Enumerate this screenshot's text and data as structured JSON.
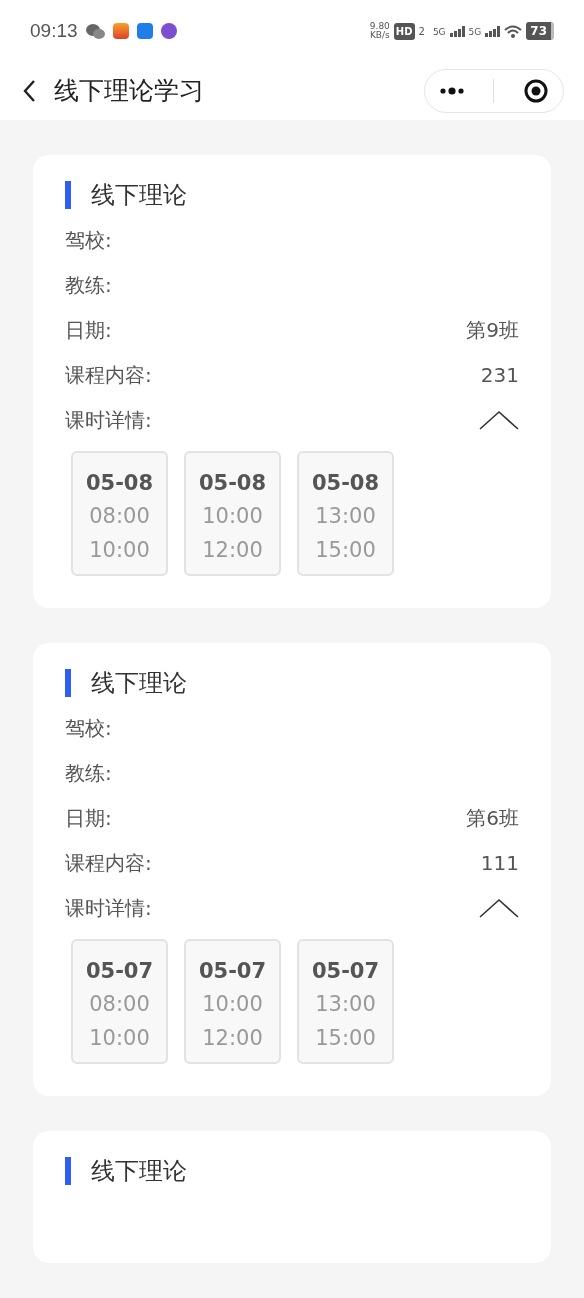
{
  "status_bar": {
    "time": "09:13",
    "speed_value": "9.80",
    "speed_unit": "KB/s",
    "hd_label": "HD",
    "hd_sub": "2",
    "signals": [
      "5G",
      "5G"
    ],
    "battery": "73"
  },
  "nav": {
    "title": "线下理论学习"
  },
  "cards": [
    {
      "title": "线下理论",
      "fields": [
        {
          "label": "驾校:"
        },
        {
          "label": "教练:"
        },
        {
          "label": "日期:",
          "value": "第9班"
        },
        {
          "label": "课程内容:",
          "value": "231"
        }
      ],
      "details_label": "课时详情:",
      "expanded": true,
      "slots": [
        {
          "date": "05-08",
          "start": "08:00",
          "end": "10:00"
        },
        {
          "date": "05-08",
          "start": "10:00",
          "end": "12:00"
        },
        {
          "date": "05-08",
          "start": "13:00",
          "end": "15:00"
        }
      ]
    },
    {
      "title": "线下理论",
      "fields": [
        {
          "label": "驾校:"
        },
        {
          "label": "教练:"
        },
        {
          "label": "日期:",
          "value": "第6班"
        },
        {
          "label": "课程内容:",
          "value": "111"
        }
      ],
      "details_label": "课时详情:",
      "expanded": true,
      "slots": [
        {
          "date": "05-07",
          "start": "08:00",
          "end": "10:00"
        },
        {
          "date": "05-07",
          "start": "10:00",
          "end": "12:00"
        },
        {
          "date": "05-07",
          "start": "13:00",
          "end": "15:00"
        }
      ]
    },
    {
      "title": "线下理论"
    }
  ]
}
